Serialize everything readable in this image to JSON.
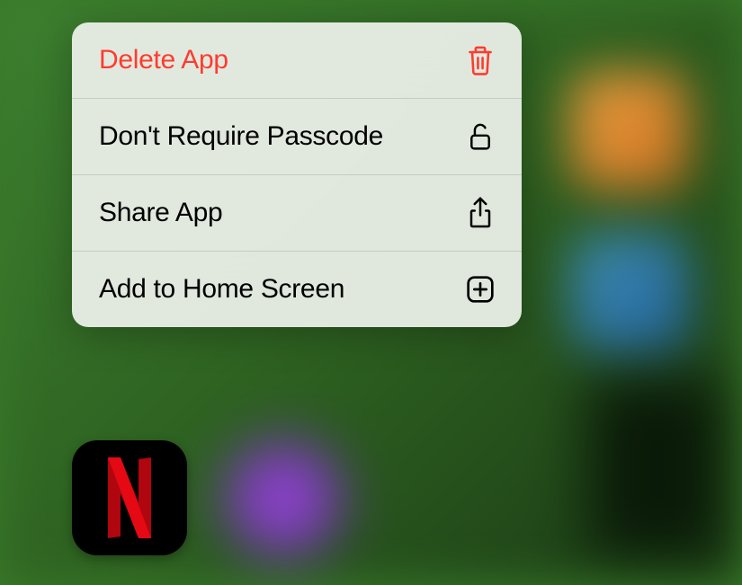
{
  "menu": {
    "items": [
      {
        "label": "Delete App",
        "icon": "trash",
        "destructive": true
      },
      {
        "label": "Don't Require Passcode",
        "icon": "unlock",
        "destructive": false
      },
      {
        "label": "Share App",
        "icon": "share",
        "destructive": false
      },
      {
        "label": "Add to Home Screen",
        "icon": "plus-square",
        "destructive": false
      }
    ]
  },
  "app": {
    "name": "Netflix"
  },
  "colors": {
    "destructive": "#ff3b30",
    "text": "#000000",
    "netflix_red": "#e50914"
  }
}
